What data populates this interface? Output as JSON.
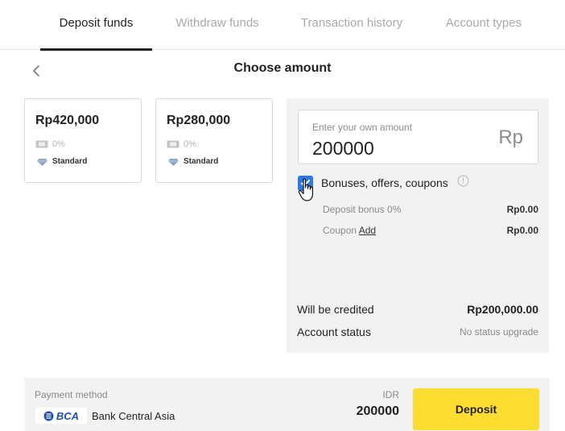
{
  "tabs": [
    {
      "label": "Deposit funds",
      "active": true
    },
    {
      "label": "Withdraw funds",
      "active": false
    },
    {
      "label": "Transaction history",
      "active": false
    },
    {
      "label": "Account types",
      "active": false
    }
  ],
  "header": {
    "title": "Choose amount",
    "back_icon": "chevron-left-icon"
  },
  "amount_options": [
    {
      "amount": "Rp420,000",
      "bonus_pct": "0%",
      "account_type": "Standard"
    },
    {
      "amount": "Rp280,000",
      "bonus_pct": "0%",
      "account_type": "Standard"
    }
  ],
  "custom_amount": {
    "placeholder": "Enter your own amount",
    "value": "200000",
    "currency": "Rp"
  },
  "bonuses": {
    "label": "Bonuses, offers, coupons",
    "checked": true,
    "deposit_bonus_label": "Deposit bonus 0%",
    "deposit_bonus_value": "Rp0.00",
    "coupon_label": "Coupon",
    "coupon_link": "Add",
    "coupon_value": "Rp0.00"
  },
  "summary": {
    "credited_label": "Will be credited",
    "credited_value": "Rp200,000.00",
    "status_label": "Account status",
    "status_value": "No status upgrade"
  },
  "payment": {
    "method_label": "Payment method",
    "bank_logo_text": "BCA",
    "bank_name": "Bank Central Asia",
    "currency_label": "IDR",
    "amount": "200000",
    "deposit_label": "Deposit"
  },
  "colors": {
    "accent_yellow": "#fedd33",
    "checkbox_blue": "#2f78e6",
    "panel_bg": "#f2f2f2"
  }
}
